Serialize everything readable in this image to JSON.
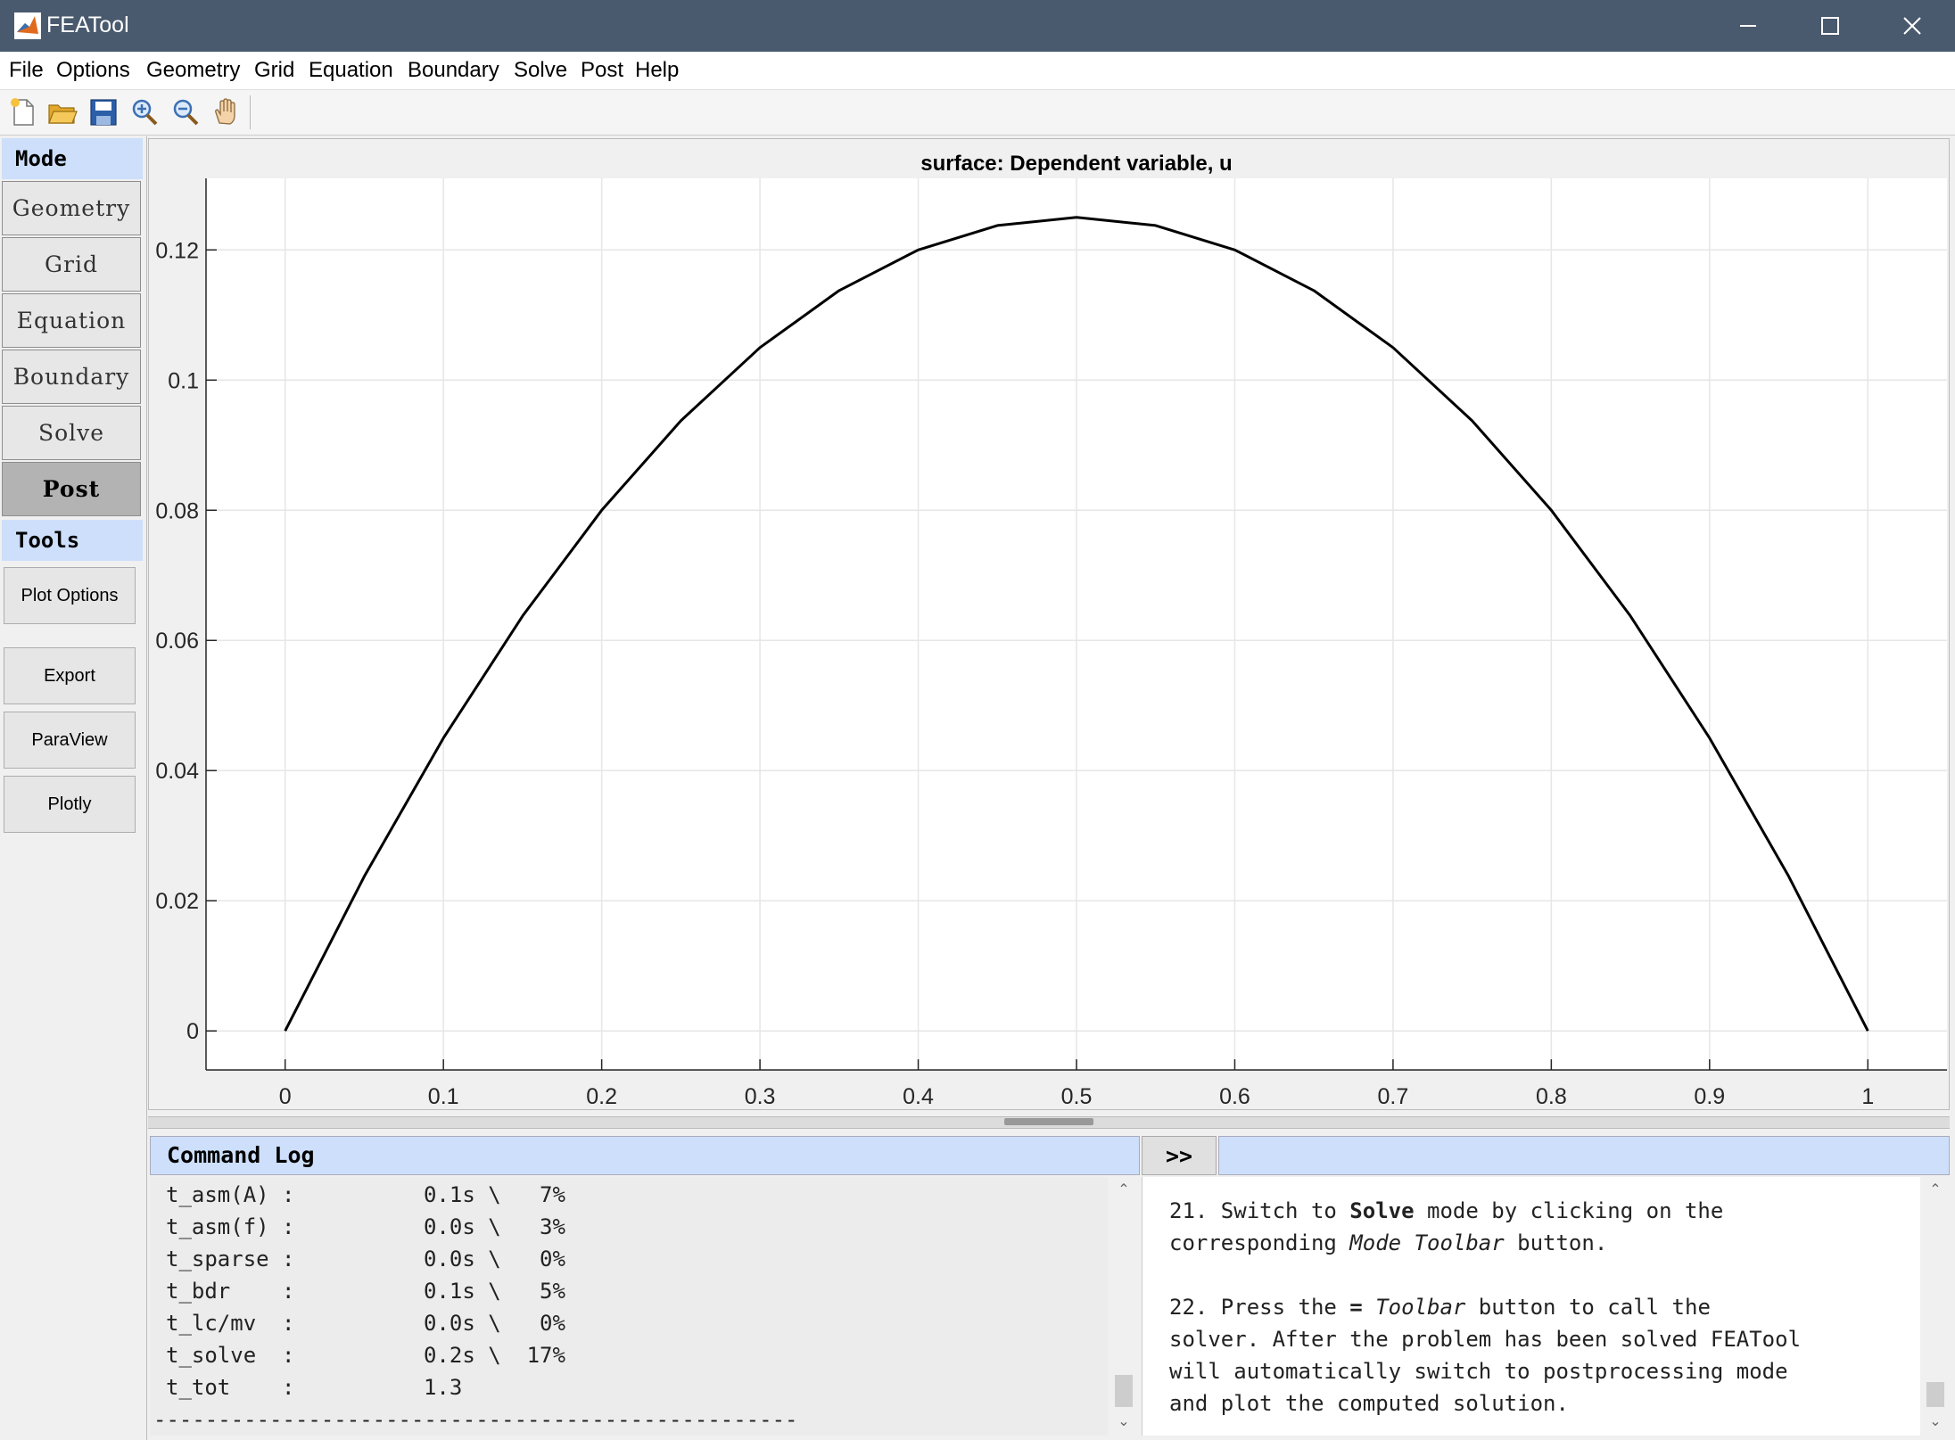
{
  "window": {
    "title": "FEATool"
  },
  "menu": [
    "File",
    "Options",
    "Geometry",
    "Grid",
    "Equation",
    "Boundary",
    "Solve",
    "Post",
    "Help"
  ],
  "toolbar": [
    "new-file-icon",
    "open-folder-icon",
    "save-icon",
    "zoom-in-icon",
    "zoom-out-icon",
    "pan-hand-icon"
  ],
  "sidebar": {
    "mode_header": "Mode",
    "modes": [
      "Geometry",
      "Grid",
      "Equation",
      "Boundary",
      "Solve",
      "Post"
    ],
    "active_mode": "Post",
    "tools_header": "Tools",
    "tools": [
      "Plot Options",
      "Export",
      "ParaView",
      "Plotly"
    ]
  },
  "chart_data": {
    "type": "line",
    "title": "surface: Dependent variable, u",
    "xlabel": "",
    "ylabel": "",
    "xlim": [
      -0.05,
      1.05
    ],
    "ylim": [
      -0.006,
      0.131
    ],
    "xticks": [
      0,
      0.1,
      0.2,
      0.3,
      0.4,
      0.5,
      0.6,
      0.7,
      0.8,
      0.9,
      1
    ],
    "yticks": [
      0,
      0.02,
      0.04,
      0.06,
      0.08,
      0.1,
      0.12
    ],
    "grid": true,
    "series": [
      {
        "color": "#000000",
        "x": [
          0,
          0.05,
          0.1,
          0.15,
          0.2,
          0.25,
          0.3,
          0.35,
          0.4,
          0.45,
          0.5,
          0.55,
          0.6,
          0.65,
          0.7,
          0.75,
          0.8,
          0.85,
          0.9,
          0.95,
          1
        ],
        "y": [
          0,
          0.02375,
          0.045,
          0.06375,
          0.08,
          0.09375,
          0.105,
          0.11375,
          0.12,
          0.12375,
          0.125,
          0.12375,
          0.12,
          0.11375,
          0.105,
          0.09375,
          0.08,
          0.06375,
          0.045,
          0.02375,
          0
        ]
      }
    ]
  },
  "command_log": {
    "header": "Command Log",
    "expand_label": ">>",
    "lines": [
      "t_asm(A) :          0.1s \\   7%",
      "t_asm(f) :          0.0s \\   3%",
      "t_sparse :          0.0s \\   0%",
      "t_bdr    :          0.1s \\   5%",
      "t_lc/mv  :          0.0s \\   0%",
      "t_solve  :          0.2s \\  17%",
      "t_tot    :          1.3",
      "--------------------------------------------------"
    ]
  },
  "help": {
    "lines": [
      [
        {
          "t": "21. Switch to "
        },
        {
          "t": "Solve",
          "b": true
        },
        {
          "t": " mode by clicking on the"
        }
      ],
      [
        {
          "t": "corresponding "
        },
        {
          "t": "Mode Toolbar",
          "i": true
        },
        {
          "t": " button."
        }
      ],
      [
        {
          "t": ""
        }
      ],
      [
        {
          "t": "22. Press the "
        },
        {
          "t": "=",
          "b": true
        },
        {
          "t": " "
        },
        {
          "t": "Toolbar",
          "i": true
        },
        {
          "t": " button to call the"
        }
      ],
      [
        {
          "t": "solver. After the problem has been solved FEATool"
        }
      ],
      [
        {
          "t": "will automatically switch to postprocessing mode"
        }
      ],
      [
        {
          "t": "and plot the computed solution."
        }
      ]
    ]
  }
}
